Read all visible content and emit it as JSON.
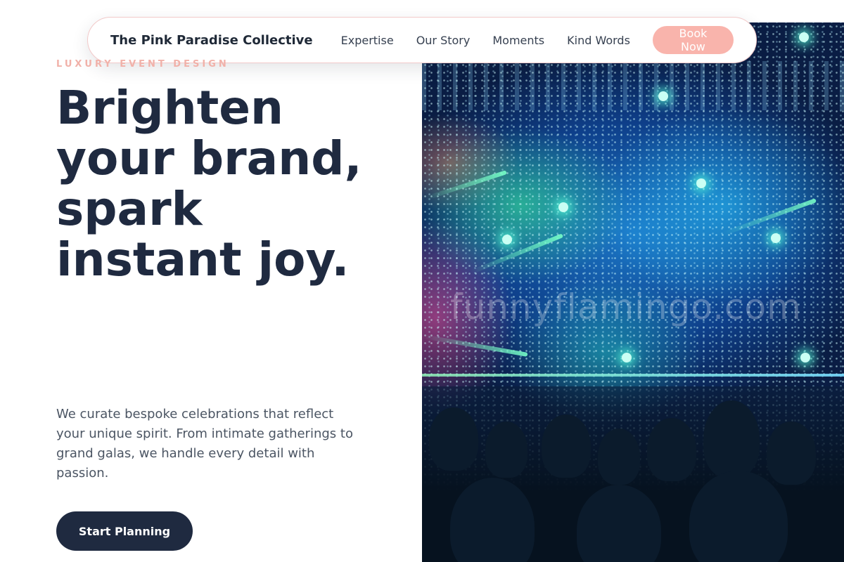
{
  "nav": {
    "brand": "The Pink Paradise Collective",
    "links": [
      "Expertise",
      "Our Story",
      "Moments",
      "Kind Words"
    ],
    "cta": "Book Now"
  },
  "hero": {
    "eyebrow": "Luxury Event Design",
    "headline": "Brighten your brand, spark instant joy.",
    "description": "We curate bespoke celebrations that reflect your unique spirit. From intimate gatherings to grand galas, we handle every detail with passion.",
    "cta": "Start Planning",
    "image_watermark": "funnyflamingo.com"
  },
  "colors": {
    "navy": "#1f2a40",
    "pink_accent": "#f9b4ac",
    "eyebrow_pink": "#f1b1a9",
    "body_text": "#4b5563"
  }
}
